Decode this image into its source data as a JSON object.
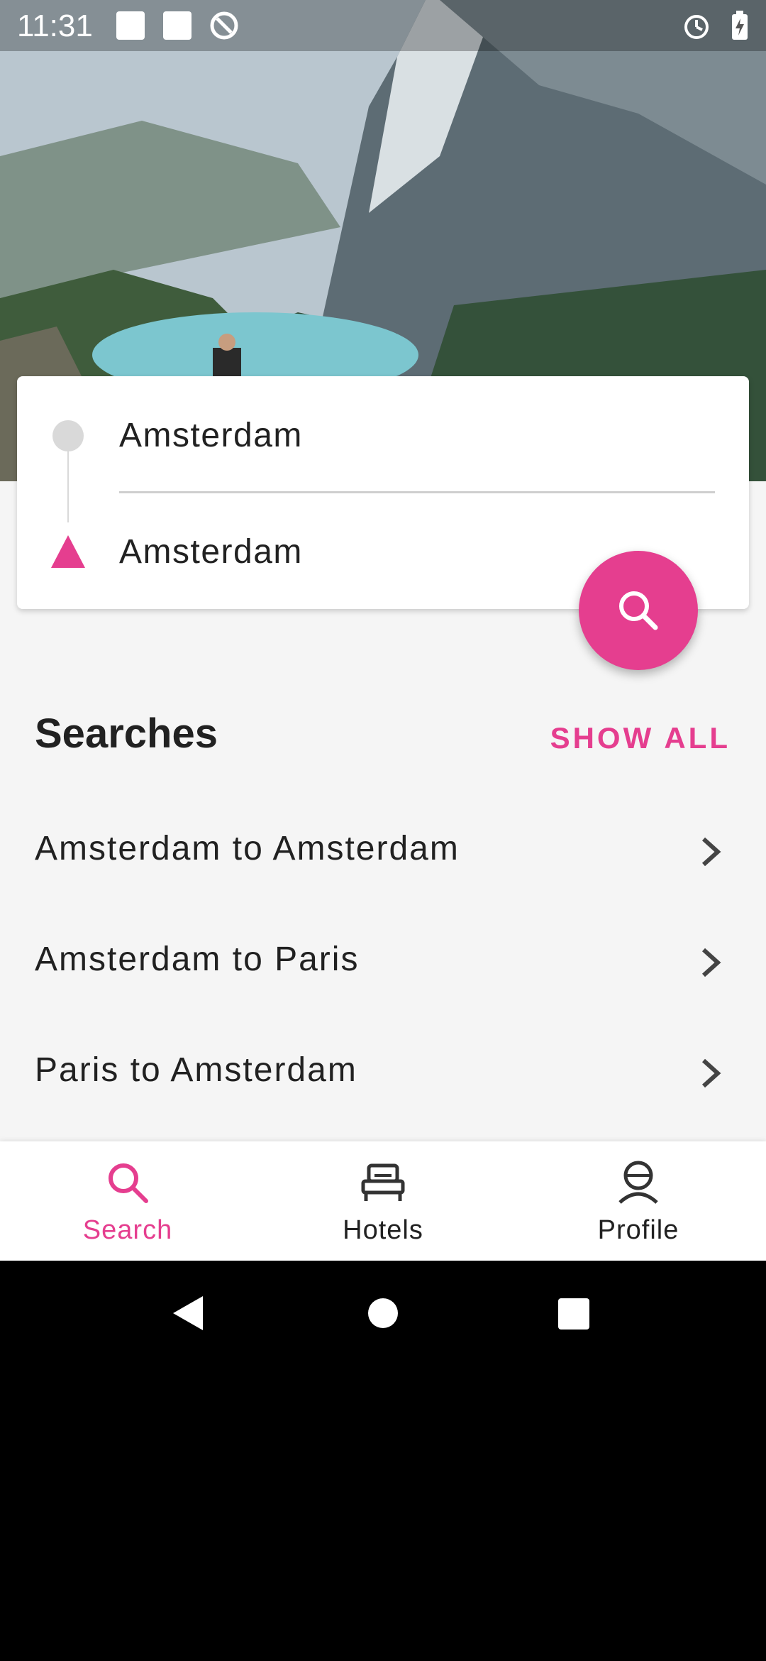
{
  "status_bar": {
    "time": "11:31"
  },
  "search_card": {
    "from_value": "Amsterdam",
    "to_value": "Amsterdam"
  },
  "searches": {
    "title": "Searches",
    "show_all_label": "SHOW ALL",
    "items": [
      {
        "label": "Amsterdam to Amsterdam"
      },
      {
        "label": "Amsterdam to Paris"
      },
      {
        "label": "Paris to Amsterdam"
      }
    ]
  },
  "bottom_nav": {
    "items": [
      {
        "label": "Search",
        "icon": "search-icon",
        "active": true
      },
      {
        "label": "Hotels",
        "icon": "bed-icon",
        "active": false
      },
      {
        "label": "Profile",
        "icon": "profile-icon",
        "active": false
      }
    ]
  },
  "colors": {
    "accent": "#e53e8f",
    "background": "#f5f5f5"
  }
}
